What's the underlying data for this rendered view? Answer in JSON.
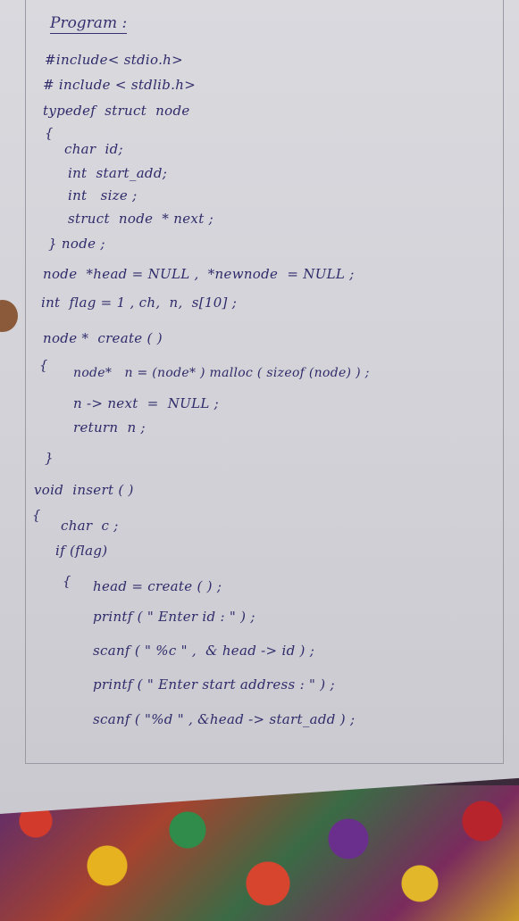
{
  "document": {
    "heading": "Program :",
    "lines": [
      "#include< stdio.h>",
      "# include < stdlib.h>",
      "typedef  struct  node",
      "{",
      "char  id;",
      "int  start_add;",
      "int   size ;",
      "struct  node  * next ;",
      "} node ;",
      "node  *head = NULL ,  *newnode  = NULL ;",
      "int  flag = 1 , ch,  n,  s[10] ;",
      "node *  create ( )",
      "{",
      "node*   n = (node* ) malloc ( sizeof (node) ) ;",
      "n -> next  =  NULL ;",
      "return  n ;",
      "}",
      "void  insert ( )",
      "{",
      "char  c ;",
      "if (flag)",
      "{",
      "head = create ( ) ;",
      "printf ( \" Enter id : \" ) ;",
      "scanf ( \" %c \" ,  & head -> id ) ;",
      "printf ( \" Enter start address : \" ) ;",
      "scanf ( \"%d \" , &head -> start_add ) ;"
    ]
  }
}
